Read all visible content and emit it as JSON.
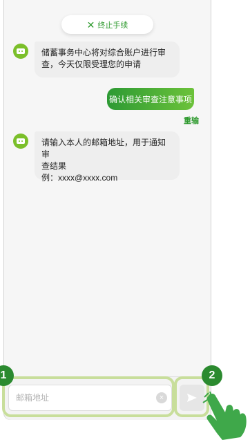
{
  "header": {
    "terminate_label": "终止手续"
  },
  "messages": [
    {
      "sender": "bot",
      "lines": [
        "储蓄事务中心将对综合账户进行审",
        "查，今天仅限受理您的申请"
      ]
    },
    {
      "sender": "user",
      "text": "确认相关审查注意事项"
    },
    {
      "sender": "bot",
      "lines": [
        "请输入本人的邮箱地址，用于通知审",
        "查结果",
        "例：xxxx@xxxx.com"
      ]
    }
  ],
  "redo_label": "重输",
  "input": {
    "placeholder": "邮箱地址",
    "clear_symbol": "×",
    "value": ""
  },
  "annotations": {
    "badge1": "1",
    "badge2": "2"
  },
  "colors": {
    "accent": "#2e9a2e",
    "highlight": "#c8de9b",
    "badge": "#2b8a2f",
    "bot_avatar": "#7bbf2a"
  },
  "icons": [
    "close-icon",
    "bot-avatar-icon",
    "clear-icon",
    "send-icon",
    "hand-pointer-icon"
  ]
}
